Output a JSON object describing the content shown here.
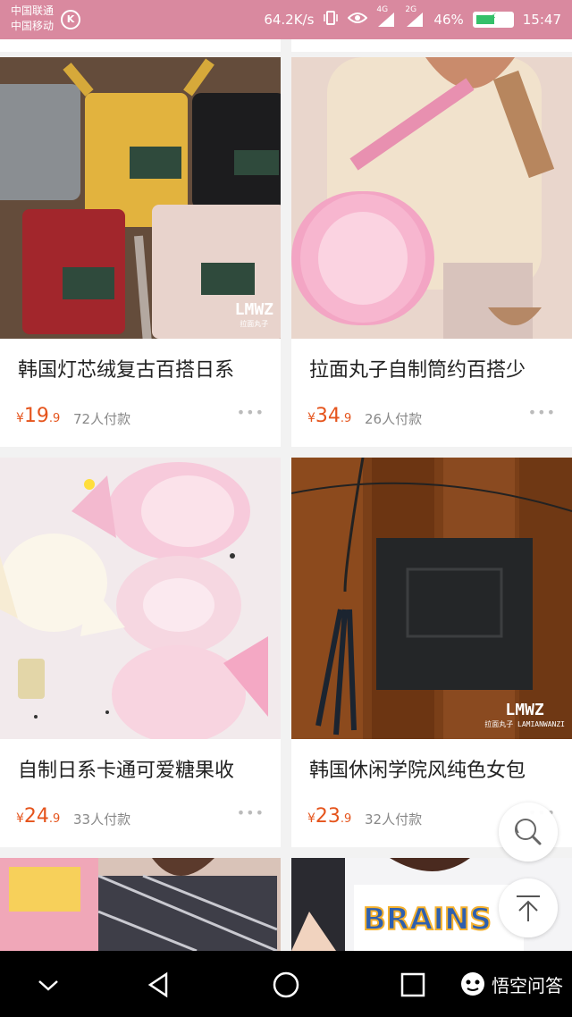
{
  "status_bar": {
    "carrier1": "中国联通",
    "carrier2": "中国移动",
    "k_badge": "K",
    "net_speed": "64.2K/s",
    "signal1": "4G",
    "signal2": "2G",
    "battery": "46%",
    "time": "15:47"
  },
  "products": [
    {
      "title": "韩国灯芯绒复古百搭日系",
      "currency": "¥",
      "price_int": "19",
      "price_dec": ".9",
      "sold": "72人付款",
      "more": "•••",
      "watermark": "LMWZ",
      "watermark_sub": "拉面丸子"
    },
    {
      "title": "拉面丸子自制筒约百搭少",
      "currency": "¥",
      "price_int": "34",
      "price_dec": ".9",
      "sold": "26人付款",
      "more": "•••"
    },
    {
      "title": "自制日系卡通可爱糖果收",
      "currency": "¥",
      "price_int": "24",
      "price_dec": ".9",
      "sold": "33人付款",
      "more": "•••"
    },
    {
      "title": "韩国休闲学院风纯色女包",
      "currency": "¥",
      "price_int": "23",
      "price_dec": ".9",
      "sold": "32人付款",
      "more": "•••",
      "watermark": "LMWZ",
      "watermark_sub": "拉面丸子 LAMIANWANZI"
    }
  ],
  "nav": {
    "brand": "悟空问答"
  },
  "colors": {
    "status_bar": "#d9899f",
    "price": "#e5541c"
  }
}
